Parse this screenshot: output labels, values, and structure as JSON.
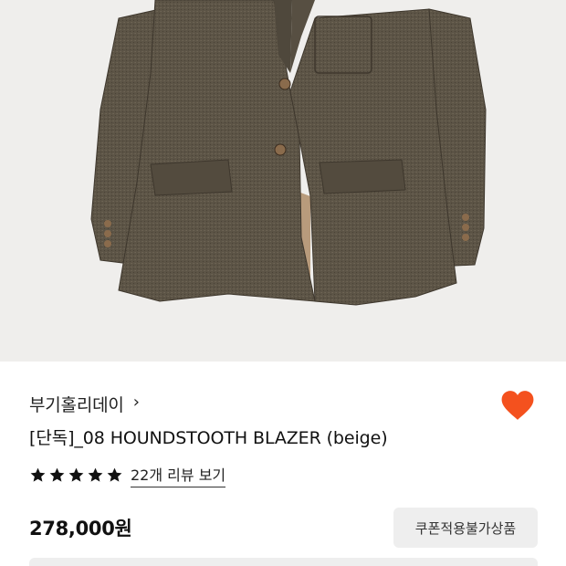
{
  "product": {
    "image_alt": "houndstooth blazer product image",
    "brand": "부기홀리데이",
    "brand_chevron": "›",
    "title": "[단독]_08 HOUNDSTOOTH BLAZER (beige)",
    "rating": {
      "stars": 5,
      "review_text": "22개 리뷰 보기"
    },
    "price": "278,000원",
    "coupon_button": "쿠폰적용불가상품"
  },
  "icons": {
    "heart": "heart-icon",
    "star": "star-icon",
    "chevron": "chevron-right-icon"
  },
  "colors": {
    "accent": "#f4511e",
    "star": "#111111",
    "jacket": "#5e5648",
    "lining": "#b89b7c",
    "button_bg": "#eeeeee"
  }
}
